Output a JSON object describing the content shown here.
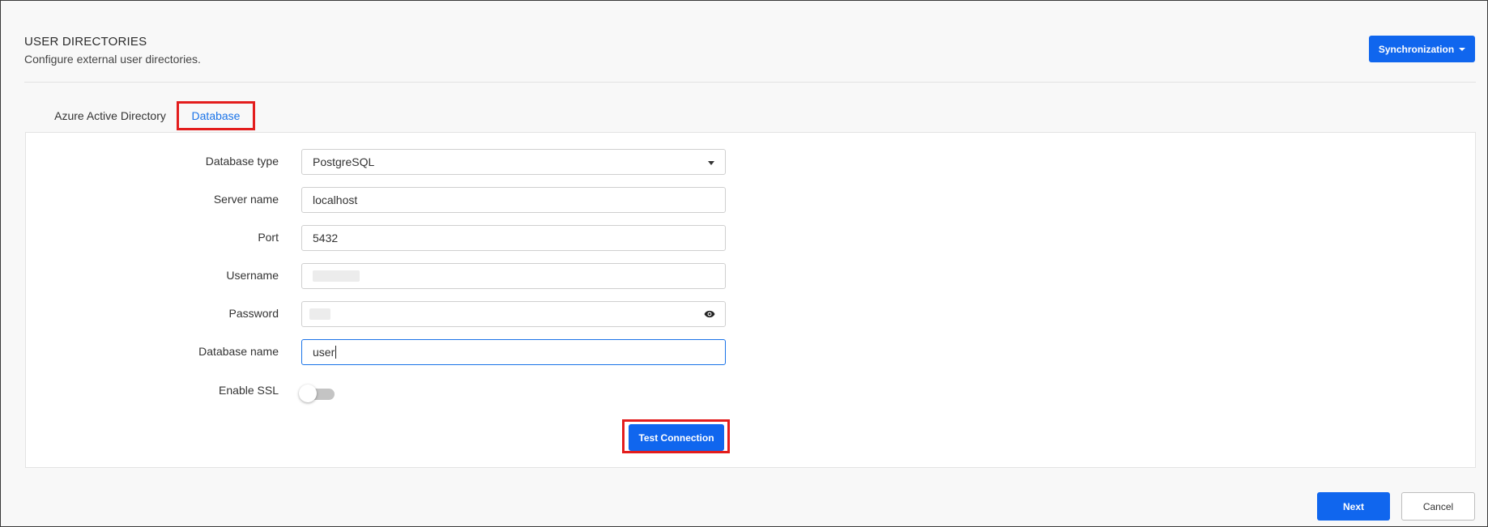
{
  "header": {
    "title": "USER DIRECTORIES",
    "subtitle": "Configure external user directories.",
    "sync_label": "Synchronization"
  },
  "tabs": [
    {
      "label": "Azure Active Directory",
      "active": false
    },
    {
      "label": "Database",
      "active": true
    }
  ],
  "form": {
    "database_type": {
      "label": "Database type",
      "value": "PostgreSQL"
    },
    "server_name": {
      "label": "Server name",
      "value": "localhost"
    },
    "port": {
      "label": "Port",
      "value": "5432"
    },
    "username": {
      "label": "Username",
      "value": ""
    },
    "password": {
      "label": "Password",
      "value": ""
    },
    "database_name": {
      "label": "Database name",
      "value": "user"
    },
    "enable_ssl": {
      "label": "Enable SSL",
      "checked": false
    }
  },
  "buttons": {
    "test_connection": "Test Connection",
    "next": "Next",
    "cancel": "Cancel"
  },
  "colors": {
    "accent": "#1066ee",
    "active_tab_text": "#1a73e8",
    "highlight": "#e31d1d"
  }
}
